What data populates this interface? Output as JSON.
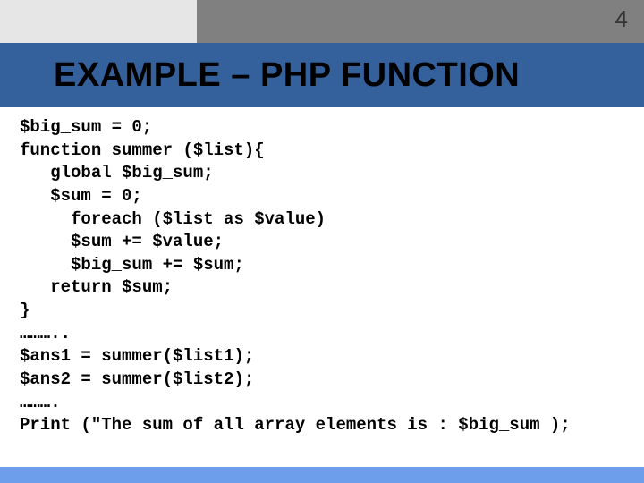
{
  "page_number": "4",
  "title": "EXAMPLE – PHP FUNCTION",
  "code": "$big_sum = 0;\nfunction summer ($list){\n   global $big_sum;\n   $sum = 0;\n     foreach ($list as $value)\n     $sum += $value;\n     $big_sum += $sum;\n   return $sum;\n}\n………..\n$ans1 = summer($list1);\n$ans2 = summer($list2);\n……….\nPrint (\"The sum of all array elements is : $big_sum );"
}
